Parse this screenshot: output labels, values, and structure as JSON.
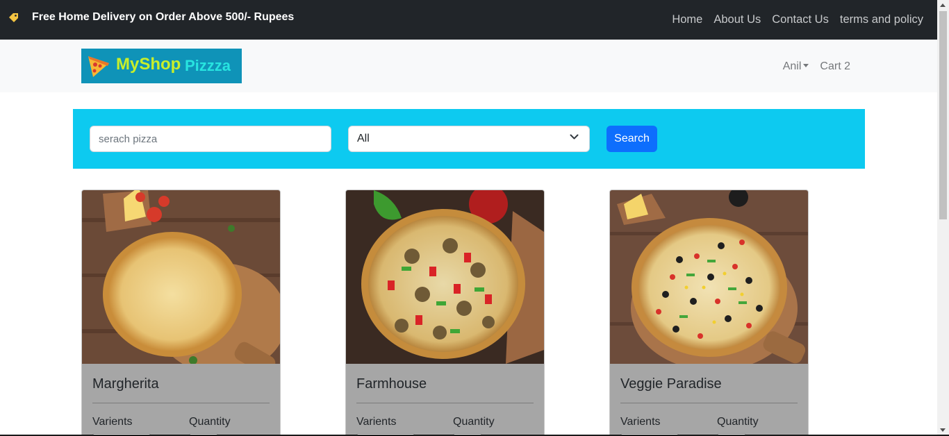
{
  "topbar": {
    "promo": "Free Home Delivery on Order Above 500/- Rupees",
    "promo_icon": "price-tag-icon",
    "nav": [
      "Home",
      "About Us",
      "Contact Us",
      "terms and policy"
    ]
  },
  "header": {
    "logo": {
      "word1": "MyShop",
      "word2": "Pizzza"
    },
    "user": "Anil",
    "cart": "Cart 2"
  },
  "search": {
    "placeholder": "serach pizza",
    "category": "All",
    "button": "Search"
  },
  "products": [
    {
      "name": "Margherita",
      "varients_label": "Varients",
      "quantity_label": "Quantity"
    },
    {
      "name": "Farmhouse",
      "varients_label": "Varients",
      "quantity_label": "Quantity"
    },
    {
      "name": "Veggie Paradise",
      "varients_label": "Varients",
      "quantity_label": "Quantity"
    }
  ],
  "colors": {
    "topbar": "#212529",
    "header": "#f8f9fa",
    "search_panel": "#0dcaf0",
    "primary_button": "#0d6efd",
    "card_body": "#a6a6a6"
  }
}
